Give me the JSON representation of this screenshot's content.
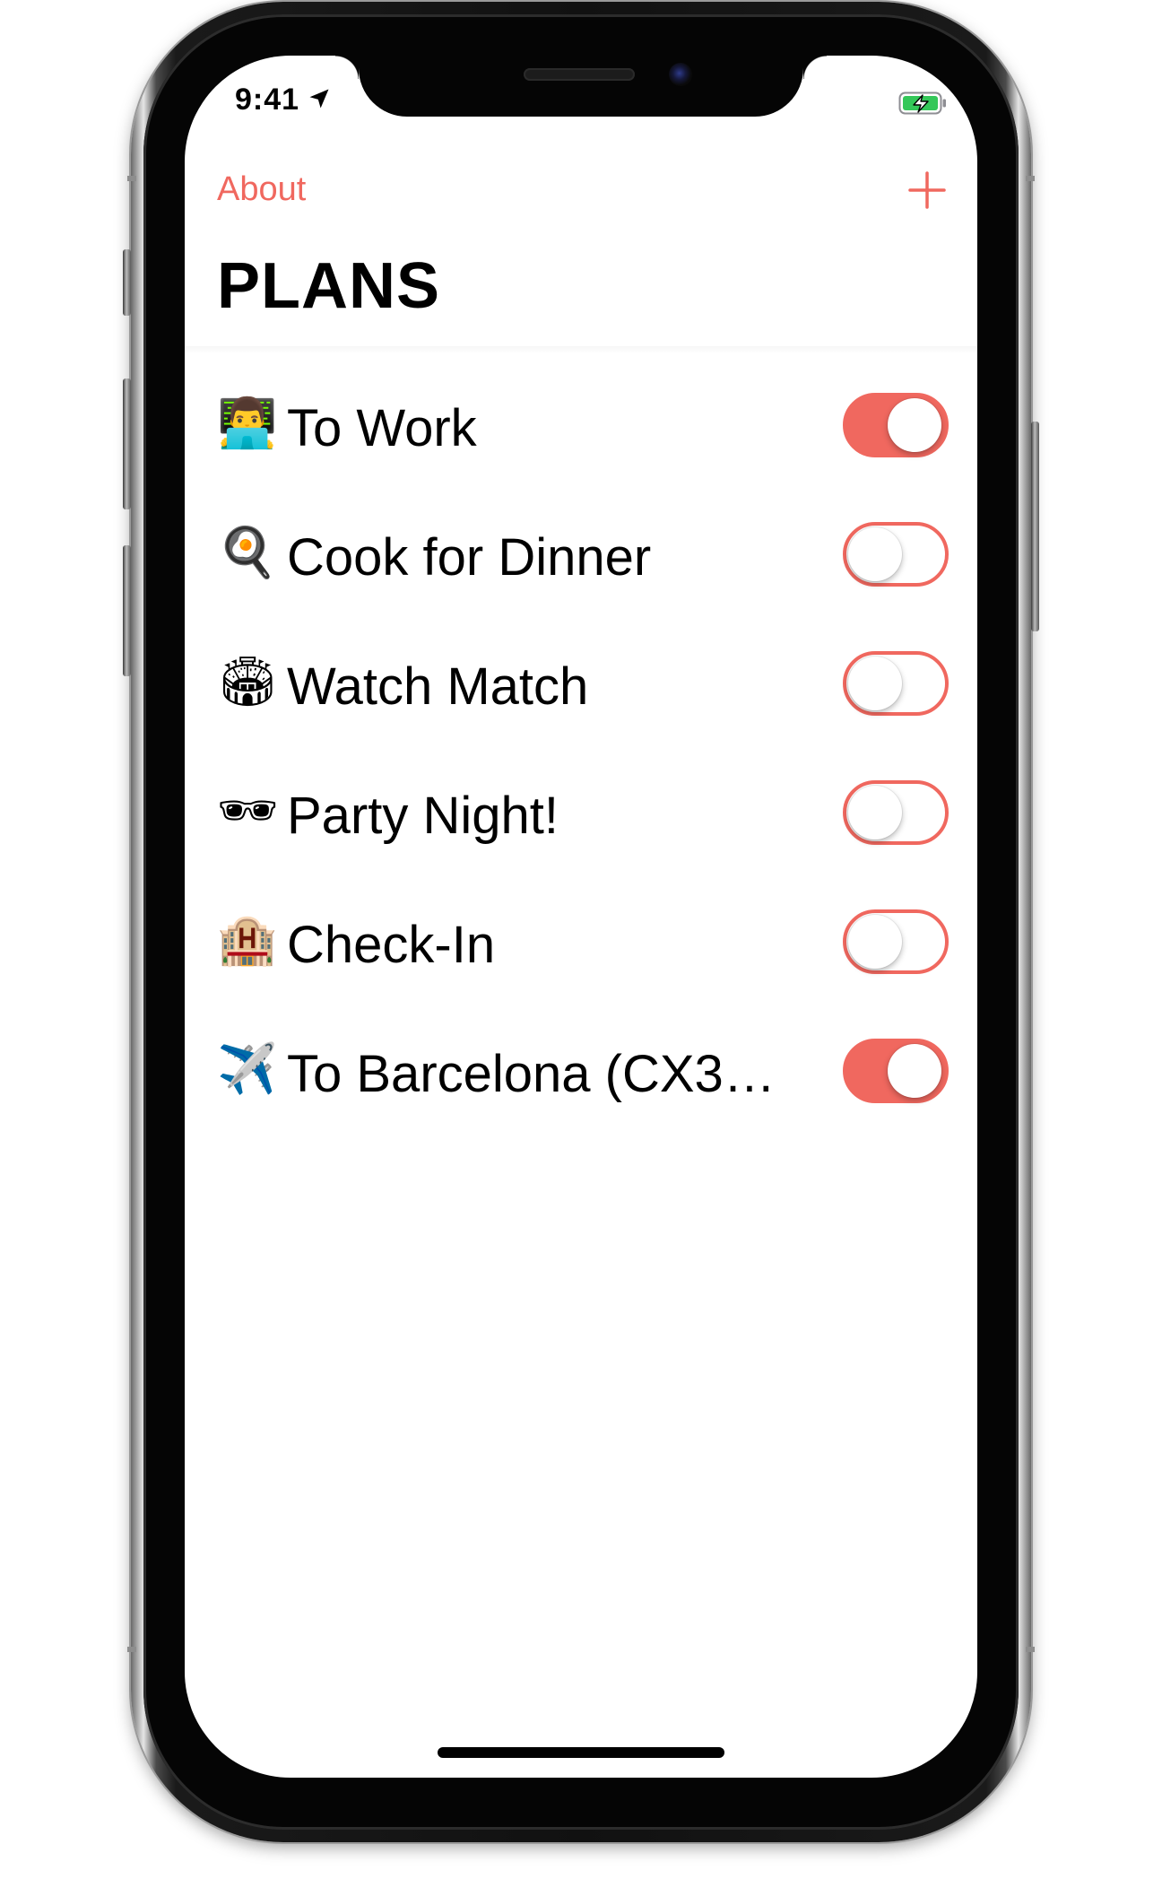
{
  "status_bar": {
    "time": "9:41",
    "location_icon": "location-arrow-icon",
    "battery_icon": "battery-charging-icon",
    "battery_color": "#34c759"
  },
  "nav": {
    "about_label": "About",
    "add_icon": "plus-icon"
  },
  "title": "PLANS",
  "accent_color": "#f0685f",
  "plans": [
    {
      "emoji": "👨‍💻",
      "icon": "technologist-emoji-icon",
      "label": "To Work",
      "enabled": true
    },
    {
      "emoji": "🍳",
      "icon": "frying-pan-egg-emoji-icon",
      "label": "Cook for Dinner",
      "enabled": false
    },
    {
      "emoji": "🏟",
      "icon": "stadium-emoji-icon",
      "label": "Watch Match",
      "enabled": false
    },
    {
      "emoji": "🕶",
      "icon": "sunglasses-emoji-icon",
      "label": "Party Night!",
      "enabled": false
    },
    {
      "emoji": "🏨",
      "icon": "hotel-emoji-icon",
      "label": "Check-In",
      "enabled": false
    },
    {
      "emoji": "✈️",
      "icon": "airplane-emoji-icon",
      "label": "To Barcelona (CX32...",
      "enabled": true
    }
  ]
}
